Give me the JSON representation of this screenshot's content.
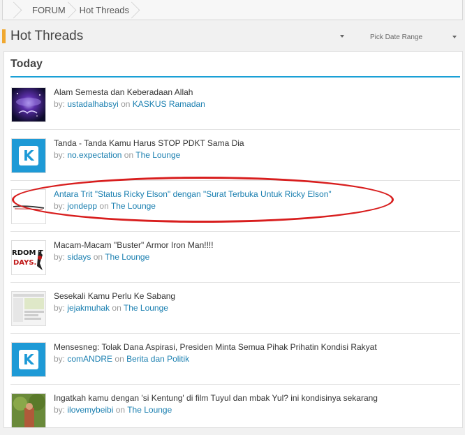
{
  "breadcrumb": {
    "items": [
      "FORUM",
      "Hot Threads"
    ]
  },
  "header": {
    "title": "Hot Threads",
    "date_range_label": "Pick Date Range"
  },
  "section": {
    "title": "Today"
  },
  "colors": {
    "accent": "#f0a830",
    "link": "#1a7fb0",
    "rule": "#1aa0d6",
    "highlight_ellipse": "#d81e1e"
  },
  "threads": [
    {
      "title": "Alam Semesta dan Keberadaan Allah",
      "by": "by:",
      "user": "ustadalhabsyi",
      "on": "on",
      "forum": "KASKUS Ramadan",
      "thumb": "galaxy-image"
    },
    {
      "title": "Tanda - Tanda Kamu Harus STOP PDKT Sama Dia",
      "by": "by:",
      "user": "no.expectation",
      "on": "on",
      "forum": "The Lounge",
      "thumb": "kaskus-logo"
    },
    {
      "title": "Antara Trit \"Status Ricky Elson\" dengan \"Surat Terbuka Untuk Ricky Elson\"",
      "by": "by:",
      "user": "jondepp",
      "on": "on",
      "forum": "The Lounge",
      "thumb": "car-image"
    },
    {
      "title": "Macam-Macam \"Buster\" Armor Iron Man!!!!",
      "by": "by:",
      "user": "sidays",
      "on": "on",
      "forum": "The Lounge",
      "thumb": "random-days-image",
      "thumb_text": "RDOM T█\nDAYS."
    },
    {
      "title": "Sesekali Kamu Perlu Ke Sabang",
      "by": "by:",
      "user": "jejakmuhak",
      "on": "on",
      "forum": "The Lounge",
      "thumb": "screenshot-image"
    },
    {
      "title": "Mensesneg: Tolak Dana Aspirasi, Presiden Minta Semua Pihak Prihatin Kondisi Rakyat",
      "by": "by:",
      "user": "comANDRE",
      "on": "on",
      "forum": "Berita dan Politik",
      "thumb": "kaskus-logo"
    },
    {
      "title": "Ingatkah kamu dengan 'si Kentung' di film Tuyul dan mbak Yul? ini kondisinya sekarang",
      "by": "by:",
      "user": "ilovemybeibi",
      "on": "on",
      "forum": "The Lounge",
      "thumb": "photo-image"
    }
  ]
}
